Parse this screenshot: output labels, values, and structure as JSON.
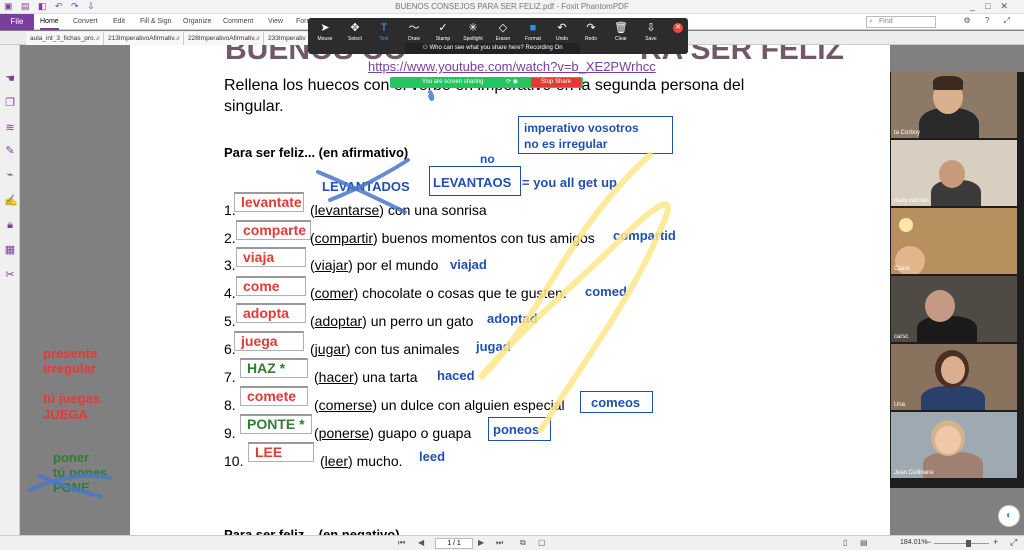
{
  "window": {
    "title": "BUENOS CONSEJOS PARA SER FELIZ.pdf - Foxit PhantomPDF",
    "controls": [
      "_",
      "□",
      "✕"
    ]
  },
  "ribbon": {
    "file_label": "File",
    "tabs": [
      "Home",
      "Convert",
      "Edit",
      "Fill & Sign",
      "Organize",
      "Comment",
      "View",
      "Form"
    ],
    "find_placeholder": "Find"
  },
  "doc_tabs": [
    "aula_int_3_fichas_pro...",
    "213ImperativoAfirmativ...",
    "228ImperativoAfirmativ...",
    "233Imperativ"
  ],
  "zoom_toolbar": {
    "tools": [
      "Mouse",
      "Select",
      "Text",
      "Draw",
      "Stamp",
      "Spotlight",
      "Eraser",
      "Format",
      "Undo",
      "Redo",
      "Clear",
      "Save"
    ],
    "active_tool": "Text",
    "recording_note": "Who can see what you share here? Recording On",
    "sharing_text": "You are screen sharing",
    "stop_label": "Stop Share"
  },
  "page": {
    "heading_partial": "BUENOS CO",
    "heading_partial_right": "RA SER FELIZ",
    "link": "https://www.youtube.com/watch?v=b_XE2PWrhcc",
    "instruction_line1": "Rellena los huecos con el verbo en imperativo en la segunda persona del",
    "instruction_line2": "singular.",
    "section_heading": "Para ser feliz... (en afirmativo)",
    "section_heading_bottom": "Para ser feliz... (en negativo)",
    "items": [
      {
        "num": "1.",
        "answer": "levantate",
        "answer_color": "#e53935",
        "verb": "levantarse",
        "rest": ") con una sonrisa",
        "note": ""
      },
      {
        "num": "2.",
        "answer": "comparte",
        "answer_color": "#e53935",
        "verb": "compartir",
        "rest": ") buenos momentos con tus amigos",
        "note": "compartid"
      },
      {
        "num": "3.",
        "answer": "viaja",
        "answer_color": "#e53935",
        "verb": "viajar",
        "rest": ") por el mundo",
        "note": "viajad"
      },
      {
        "num": "4.",
        "answer": "come",
        "answer_color": "#e53935",
        "verb": "comer",
        "rest": ") chocolate o cosas que te gusten.",
        "note": "comed"
      },
      {
        "num": "5.",
        "answer": "adopta",
        "answer_color": "#e53935",
        "verb": "adoptar",
        "rest": ") un perro un gato",
        "note": "adoptad"
      },
      {
        "num": "6.",
        "answer": "juega",
        "answer_color": "#e53935",
        "verb": "jugar",
        "rest": ") con tus animales",
        "note": "jugad"
      },
      {
        "num": "7.",
        "answer": "HAZ *",
        "answer_color": "#2e7d32",
        "verb": "hacer",
        "rest": ") una tarta",
        "note": "haced"
      },
      {
        "num": "8.",
        "answer": "comete",
        "answer_color": "#e53935",
        "verb": "comerse",
        "rest": ") un dulce con alguien especial",
        "note": "comeos"
      },
      {
        "num": "9.",
        "answer": "PONTE *",
        "answer_color": "#2e7d32",
        "verb": "ponerse",
        "rest": ") guapo o guapa",
        "note": "poneos"
      },
      {
        "num": "10.",
        "answer": "LEE",
        "answer_color": "#e53935",
        "verb": "leer",
        "rest": ") mucho.",
        "note": "leed"
      }
    ],
    "notes": {
      "imperativo_box_line1": "imperativo vosotros",
      "imperativo_box_line2": "no es irregular",
      "no": "no",
      "levantados": "LEVANTADOS",
      "levantaos_box": "LEVANTAOS",
      "you_all": "= you all get up"
    }
  },
  "left_notes": {
    "presente": "presente",
    "irregular": "irregular",
    "tu_juegas": "tú juegas",
    "juega": "JUEGA",
    "poner": "poner",
    "tu_pones": "tú pones",
    "pone": "PONE"
  },
  "gallery": [
    {
      "name": "ta Corboy"
    },
    {
      "name": "mary carolan"
    },
    {
      "name": "Claire"
    },
    {
      "name": "carsc"
    },
    {
      "name": "Una"
    },
    {
      "name": "Jean Cullinane"
    }
  ],
  "status": {
    "page_indicator": "1 / 1",
    "zoom": "184.01%"
  }
}
